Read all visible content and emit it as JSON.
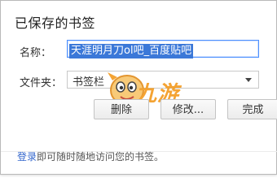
{
  "dialog": {
    "title": "已保存的书签",
    "name_label": "名称：",
    "name_value": "天涯明月刀ol吧_百度贴吧",
    "folder_label": "文件夹：",
    "folder_value": "书签栏",
    "buttons": {
      "delete": "删除",
      "edit": "修改...",
      "done": "完成"
    },
    "footer": {
      "link": "登录",
      "text": "即可随时随地访问您的书签。"
    }
  },
  "watermark": {
    "text": "九游"
  },
  "colors": {
    "accent": "#3b78d8",
    "link": "#3366cc",
    "watermark": "#f39a1e"
  }
}
